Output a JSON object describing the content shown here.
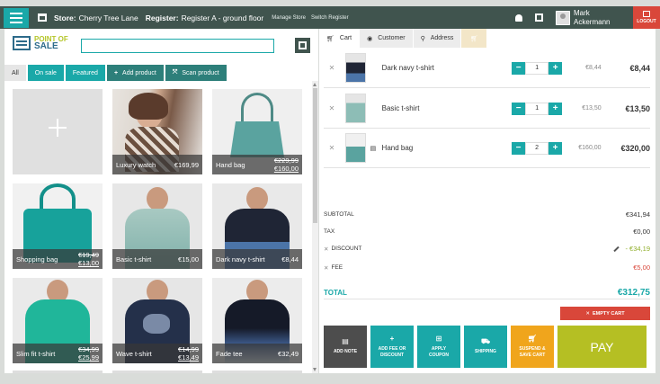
{
  "header": {
    "store_label": "Store:",
    "store_value": "Cherry Tree Lane",
    "register_label": "Register:",
    "register_value": "Register A - ground floor",
    "manage_store": "Manage Store",
    "switch_register": "Switch Register",
    "user_first": "Mark",
    "user_last": "Ackermann",
    "logout": "LOGOUT"
  },
  "logo": {
    "line1": "POINT OF",
    "line2": "SALE"
  },
  "search": {
    "value": "",
    "placeholder": ""
  },
  "filters": {
    "all": "All",
    "on_sale": "On sale",
    "featured": "Featured",
    "add_product": "Add product",
    "scan_product": "Scan product"
  },
  "products": [
    {
      "name": "Luxury watch",
      "price": "€169,99"
    },
    {
      "name": "Hand bag",
      "old_price": "€229,99",
      "price": "€160,00"
    },
    {
      "name": "Shopping bag",
      "old_price": "€19,49",
      "price": "€13,00"
    },
    {
      "name": "Basic t-shirt",
      "price": "€15,00"
    },
    {
      "name": "Dark navy t-shirt",
      "price": "€8,44"
    },
    {
      "name": "Slim fit t-shirt",
      "old_price": "€34,99",
      "price": "€25,99"
    },
    {
      "name": "Wave t-shirt",
      "old_price": "€14,99",
      "price": "€13,49"
    },
    {
      "name": "Fade tee",
      "price": "€32,49"
    }
  ],
  "tabs": {
    "cart": "Cart",
    "customer": "Customer",
    "address": "Address"
  },
  "cart": [
    {
      "name": "Dark navy t-shirt",
      "qty": "1",
      "unit": "€8,44",
      "total": "€8,44"
    },
    {
      "name": "Basic t-shirt",
      "qty": "1",
      "unit": "€13,50",
      "total": "€13,50"
    },
    {
      "name": "Hand bag",
      "qty": "2",
      "unit": "€160,00",
      "total": "€320,00"
    }
  ],
  "totals": {
    "subtotal_label": "SUBTOTAL",
    "subtotal": "€341,94",
    "tax_label": "TAX",
    "tax": "€0,00",
    "discount_label": "DISCOUNT",
    "discount": "- €34,19",
    "fee_label": "FEE",
    "fee": "€5,00",
    "total_label": "TOTAL",
    "total": "€312,75"
  },
  "actions": {
    "empty_cart": "EMPTY CART",
    "add_note": "ADD NOTE",
    "add_fee_1": "ADD FEE OR",
    "add_fee_2": "DISCOUNT",
    "coupon_1": "APPLY",
    "coupon_2": "COUPON",
    "shipping": "SHIPPING",
    "suspend_1": "SUSPEND &",
    "suspend_2": "SAVE CART",
    "pay": "PAY"
  },
  "colors": {
    "accent": "#1aa8a8",
    "header": "#40544e",
    "danger": "#d9473a",
    "pay": "#b5bf23",
    "suspend": "#f0a51c",
    "discount": "#8fae2a",
    "fee": "#d9473a"
  }
}
